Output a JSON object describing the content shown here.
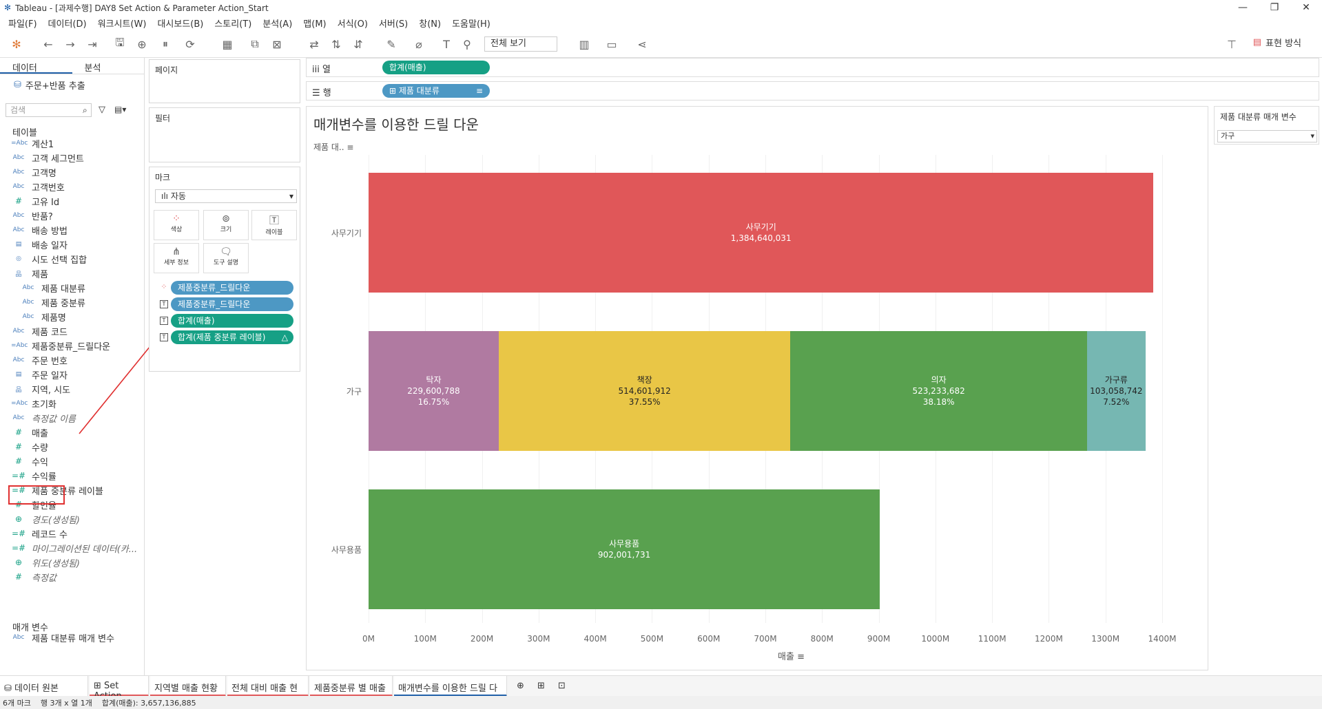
{
  "window": {
    "title": "Tableau - [과제수행] DAY8 Set Action & Parameter Action_Start"
  },
  "menu": [
    "파일(F)",
    "데이터(D)",
    "워크시트(W)",
    "대시보드(B)",
    "스토리(T)",
    "분석(A)",
    "맵(M)",
    "서식(O)",
    "서버(S)",
    "창(N)",
    "도움말(H)"
  ],
  "toolbar": {
    "view_select": "전체 보기",
    "show_me": "표현 방식"
  },
  "left": {
    "tab_data": "데이터",
    "tab_analysis": "분석",
    "datasource": "주문+반품 추출",
    "search_placeholder": "검색",
    "tables_header": "테이블",
    "fields": [
      {
        "icon": "=Abc",
        "name": "계산1"
      },
      {
        "icon": "Abc",
        "name": "고객 세그먼트"
      },
      {
        "icon": "Abc",
        "name": "고객명"
      },
      {
        "icon": "Abc",
        "name": "고객번호"
      },
      {
        "icon": "#",
        "name": "고유 Id"
      },
      {
        "icon": "Abc",
        "name": "반품?"
      },
      {
        "icon": "Abc",
        "name": "배송 방법"
      },
      {
        "icon": "cal",
        "name": "배송 일자"
      },
      {
        "icon": "set",
        "name": "시도 선택 집합"
      },
      {
        "icon": "hier",
        "name": "제품"
      },
      {
        "icon": "Abc",
        "name": "제품 대분류"
      },
      {
        "icon": "Abc",
        "name": "제품 중분류"
      },
      {
        "icon": "Abc",
        "name": "제품명"
      },
      {
        "icon": "Abc",
        "name": "제품 코드"
      },
      {
        "icon": "=Abc",
        "name": "제품중분류_드릴다운"
      },
      {
        "icon": "Abc",
        "name": "주문 번호"
      },
      {
        "icon": "cal",
        "name": "주문 일자"
      },
      {
        "icon": "hier",
        "name": "지역, 시도"
      },
      {
        "icon": "=Abc",
        "name": "초기화"
      },
      {
        "icon": "Abc",
        "name": "측정값 이름"
      },
      {
        "icon": "#",
        "name": "매출"
      },
      {
        "icon": "#",
        "name": "수량"
      },
      {
        "icon": "#",
        "name": "수익"
      },
      {
        "icon": "=#",
        "name": "수익률"
      },
      {
        "icon": "=#",
        "name": "제품 중분류 레이블"
      },
      {
        "icon": "#",
        "name": "할인율"
      },
      {
        "icon": "globe",
        "name": "경도(생성됨)"
      },
      {
        "icon": "=#",
        "name": "레코드 수"
      },
      {
        "icon": "=#",
        "name": "마이그레이션된 데이터(카..."
      },
      {
        "icon": "globe",
        "name": "위도(생성됨)"
      },
      {
        "icon": "#",
        "name": "측정값"
      }
    ],
    "params_header": "매개 변수",
    "param_field": "제품 대분류 매개 변수"
  },
  "cards": {
    "pages": "페이지",
    "filters": "필터",
    "marks": "마크",
    "marks_type": "자동",
    "mark_buttons": [
      "색상",
      "크기",
      "레이블",
      "세부 정보",
      "도구 설명"
    ],
    "mark_pills": [
      "제품중분류_드릴다운",
      "제품중분류_드릴다운",
      "합계(매출)",
      "합계(제품 중분류 레이블)"
    ]
  },
  "shelves": {
    "columns_label": "열",
    "columns_pill": "합계(매출)",
    "rows_label": "행",
    "rows_pill": "제품 대분류"
  },
  "viz": {
    "title": "매개변수를 이용한 드릴 다운",
    "row_header": "제품 대.."
  },
  "parameter": {
    "title": "제품 대분류 매개 변수",
    "value": "가구"
  },
  "chart_data": {
    "type": "bar",
    "orientation": "horizontal-stacked",
    "categories": [
      "사무기기",
      "가구",
      "사무용품"
    ],
    "segments": [
      {
        "category": "사무기기",
        "name": "사무기기",
        "value": 1384640031,
        "label": "1,384,640,031",
        "pct": "",
        "color": "#e05759"
      },
      {
        "category": "가구",
        "name": "탁자",
        "value": 229600788,
        "label": "229,600,788",
        "pct": "16.75%",
        "color": "#b07aa1"
      },
      {
        "category": "가구",
        "name": "책장",
        "value": 514601912,
        "label": "514,601,912",
        "pct": "37.55%",
        "color": "#e9c646"
      },
      {
        "category": "가구",
        "name": "의자",
        "value": 523233682,
        "label": "523,233,682",
        "pct": "38.18%",
        "color": "#59a14f"
      },
      {
        "category": "가구",
        "name": "가구류",
        "value": 103058742,
        "label": "103,058,742",
        "pct": "7.52%",
        "color": "#76b7b2"
      },
      {
        "category": "사무용품",
        "name": "사무용품",
        "value": 902001731,
        "label": "902,001,731",
        "pct": "",
        "color": "#59a14f"
      }
    ],
    "xticks": [
      "0M",
      "100M",
      "200M",
      "300M",
      "400M",
      "500M",
      "600M",
      "700M",
      "800M",
      "900M",
      "1000M",
      "1100M",
      "1200M",
      "1300M",
      "1400M"
    ],
    "xlim": [
      0,
      1450000000
    ],
    "xlabel": "매출"
  },
  "sheets": [
    "데이터 원본",
    "Set Action",
    "지역별 매출 현황",
    "전체 대비 매출 현황",
    "제품중분류 별 매출",
    "매개변수를 이용한 드릴 다운"
  ],
  "status": {
    "marks": "6개 마크",
    "rowscols": "행 3개 x 열 1개",
    "sum": "합계(매출): 3,657,136,885"
  }
}
